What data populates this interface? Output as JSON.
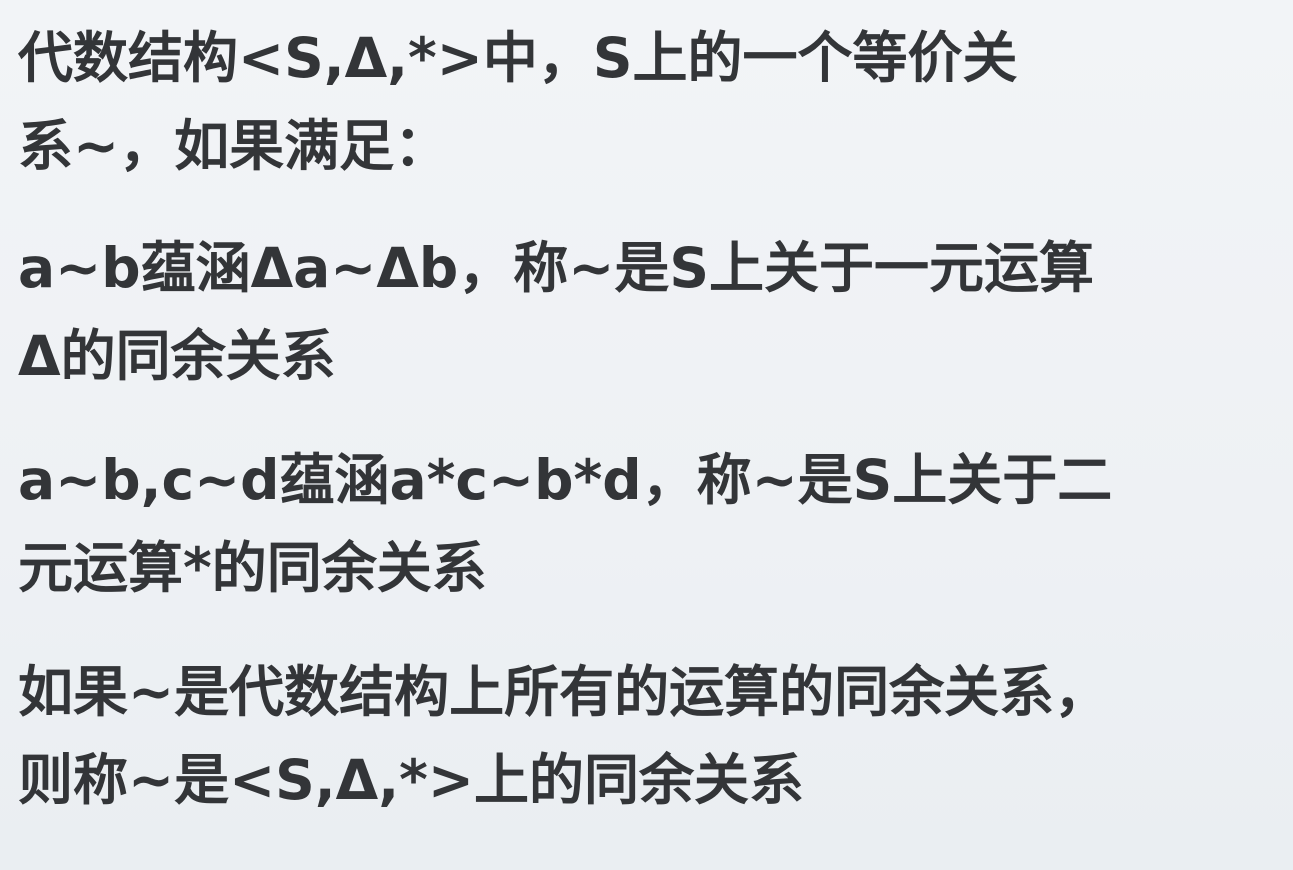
{
  "slide": {
    "paragraphs": [
      {
        "lines": [
          "代数结构<S,Δ,*>中，S上的一个等价关",
          "系~，如果满足："
        ]
      },
      {
        "lines": [
          "a~b蕴涵Δa~Δb，称~是S上关于一元运算",
          "Δ的同余关系"
        ]
      },
      {
        "lines": [
          "a~b,c~d蕴涵a*c~b*d，称~是S上关于二",
          "元运算*的同余关系"
        ]
      },
      {
        "lines": [
          "如果~是代数结构上所有的运算的同余关系，",
          "则称~是<S,Δ,*>上的同余关系"
        ]
      }
    ]
  }
}
